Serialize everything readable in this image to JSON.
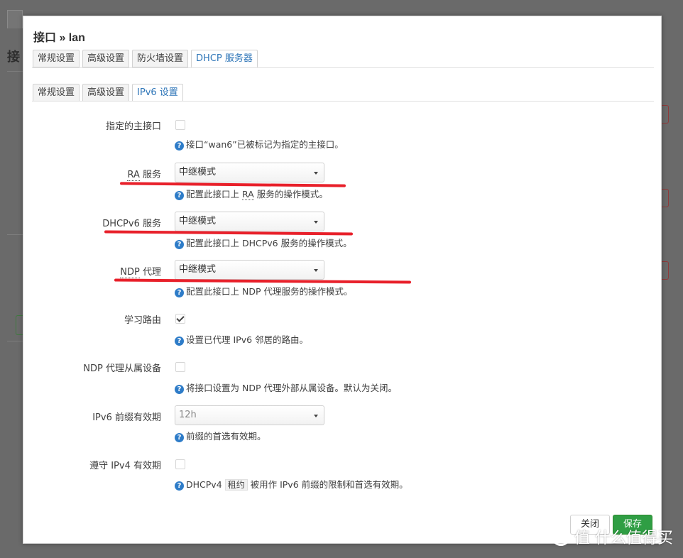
{
  "background": {
    "tab_label": "接",
    "title": "接"
  },
  "modal": {
    "title": "接口 » lan",
    "tabs": [
      {
        "label": "常规设置",
        "active": false
      },
      {
        "label": "高级设置",
        "active": false
      },
      {
        "label": "防火墙设置",
        "active": false
      },
      {
        "label": "DHCP 服务器",
        "active": true
      }
    ],
    "subtabs": [
      {
        "label": "常规设置",
        "active": false
      },
      {
        "label": "高级设置",
        "active": false
      },
      {
        "label": "IPv6 设置",
        "active": true
      }
    ],
    "fields": {
      "master": {
        "label": "指定的主接口",
        "checked": false,
        "help": "接口“wan6”已被标记为指定的主接口。"
      },
      "ra": {
        "label_abbr": "RA",
        "label_rest": " 服务",
        "value": "中继模式",
        "help_pre": "配置此接口上 ",
        "help_abbr": "RA",
        "help_post": " 服务的操作模式。"
      },
      "dhcpv6": {
        "label": "DHCPv6 服务",
        "value": "中继模式",
        "help": "配置此接口上 DHCPv6 服务的操作模式。"
      },
      "ndp": {
        "label_abbr": "NDP",
        "label_rest": " 代理",
        "value": "中继模式",
        "help": "配置此接口上 NDP 代理服务的操作模式。"
      },
      "learn_routes": {
        "label": "学习路由",
        "checked": true,
        "help": "设置已代理 IPv6 邻居的路由。"
      },
      "ndp_slave": {
        "label": "NDP 代理从属设备",
        "checked": false,
        "help": "将接口设置为 NDP 代理外部从属设备。默认为关闭。"
      },
      "prefix_lifetime": {
        "label": "IPv6 前缀有效期",
        "value": "12h",
        "help": "前缀的首选有效期。"
      },
      "ipv4_lifetime": {
        "label": "遵守 IPv4 有效期",
        "checked": false,
        "help_pre": "DHCPv4 ",
        "help_code": "租约",
        "help_post": " 被用作 IPv6 前缀的限制和首选有效期。"
      }
    },
    "buttons": {
      "close": "关闭",
      "save": "保存"
    }
  },
  "watermark": "值 什么值得买",
  "colors": {
    "accent": "#2f76b8",
    "save": "#2f9e44",
    "annotation": "#e8202a"
  }
}
